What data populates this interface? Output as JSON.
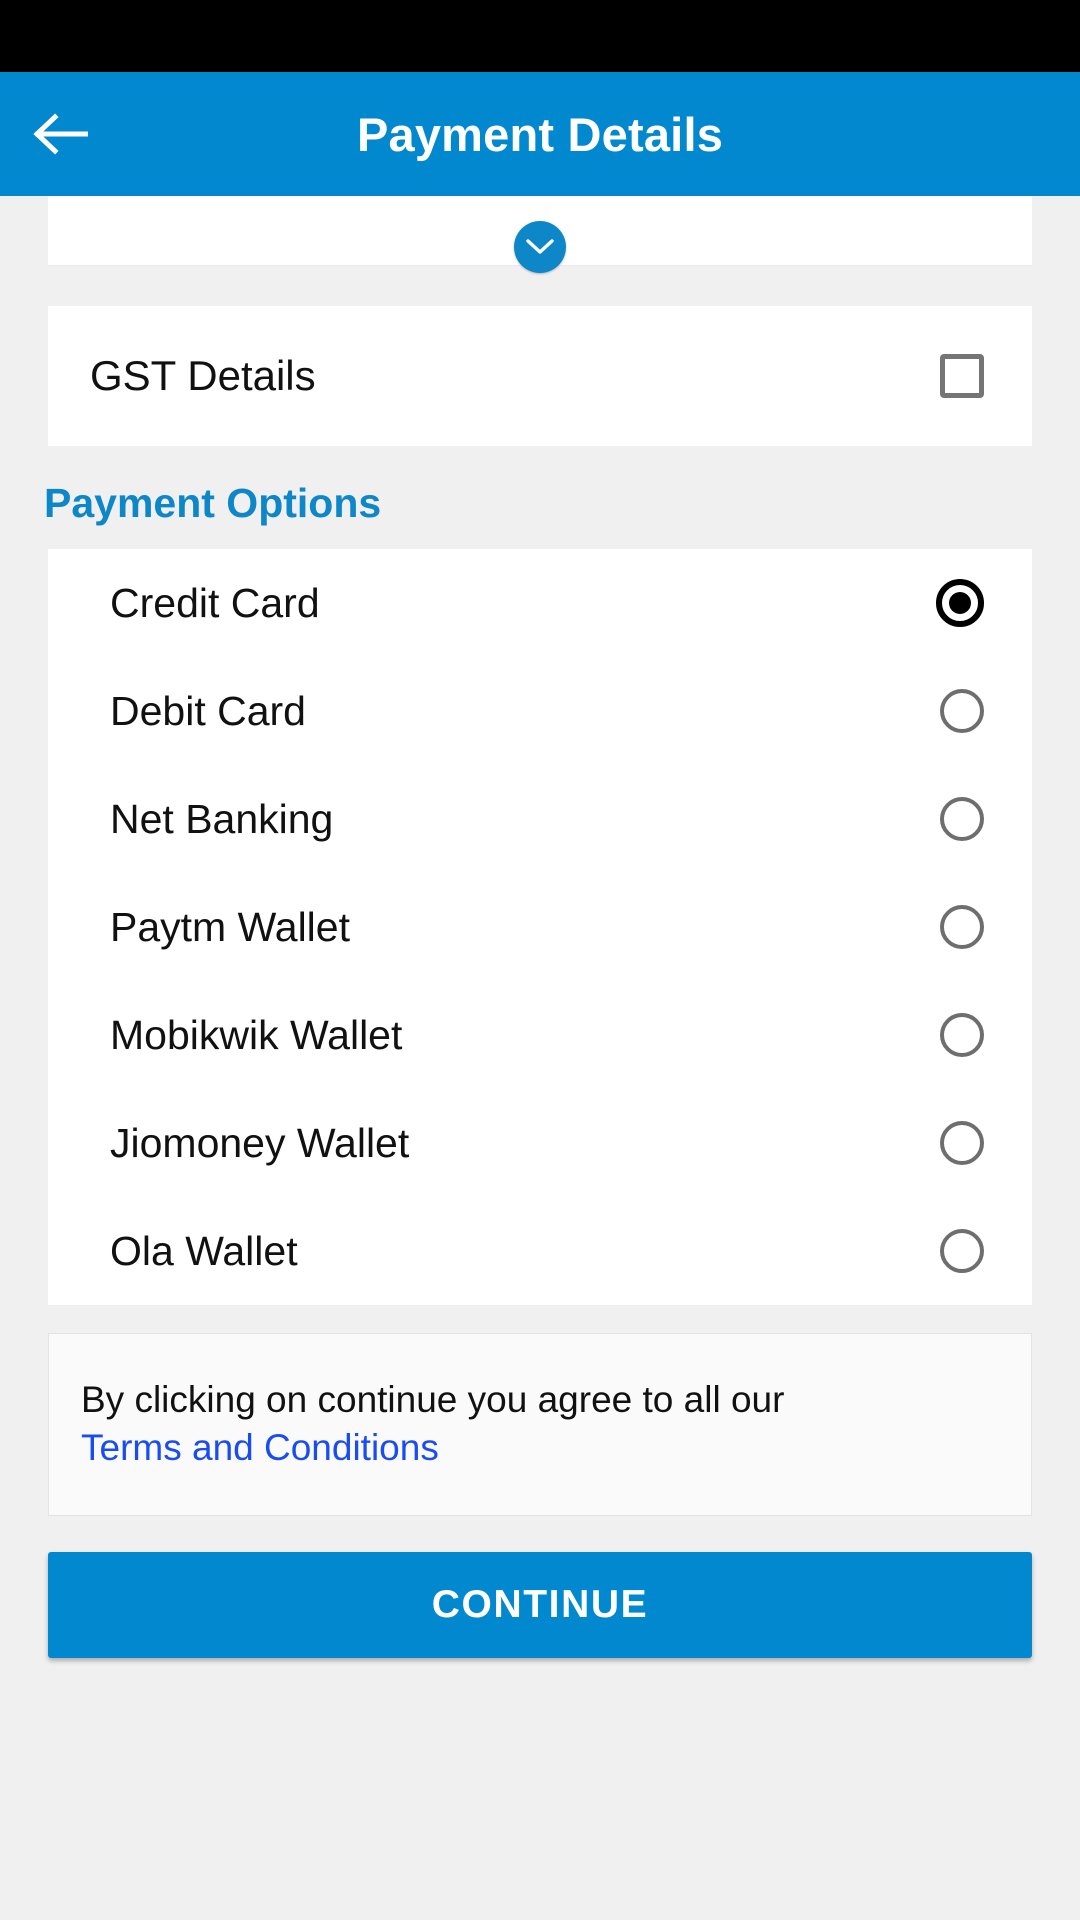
{
  "app_bar": {
    "title": "Payment Details",
    "back_icon": "arrow-left-icon",
    "background_color": "#0288CE"
  },
  "summary": {
    "expand_icon": "chevron-down-icon",
    "expand_button_color": "#0E87C8"
  },
  "gst": {
    "label": "GST Details",
    "checked": false
  },
  "payment_options": {
    "heading": "Payment Options",
    "heading_color": "#0E87C8",
    "selected": "Credit Card",
    "items": [
      {
        "label": "Credit Card",
        "selected": true
      },
      {
        "label": "Debit Card",
        "selected": false
      },
      {
        "label": "Net Banking",
        "selected": false
      },
      {
        "label": "Paytm Wallet",
        "selected": false
      },
      {
        "label": "Mobikwik Wallet",
        "selected": false
      },
      {
        "label": "Jiomoney Wallet",
        "selected": false
      },
      {
        "label": "Ola Wallet",
        "selected": false
      }
    ]
  },
  "terms": {
    "text": "By clicking on continue you agree to all our",
    "link_label": "Terms and Conditions",
    "link_color": "#1A4DF0"
  },
  "footer": {
    "continue_label": "CONTINUE",
    "continue_color": "#0288CE"
  }
}
